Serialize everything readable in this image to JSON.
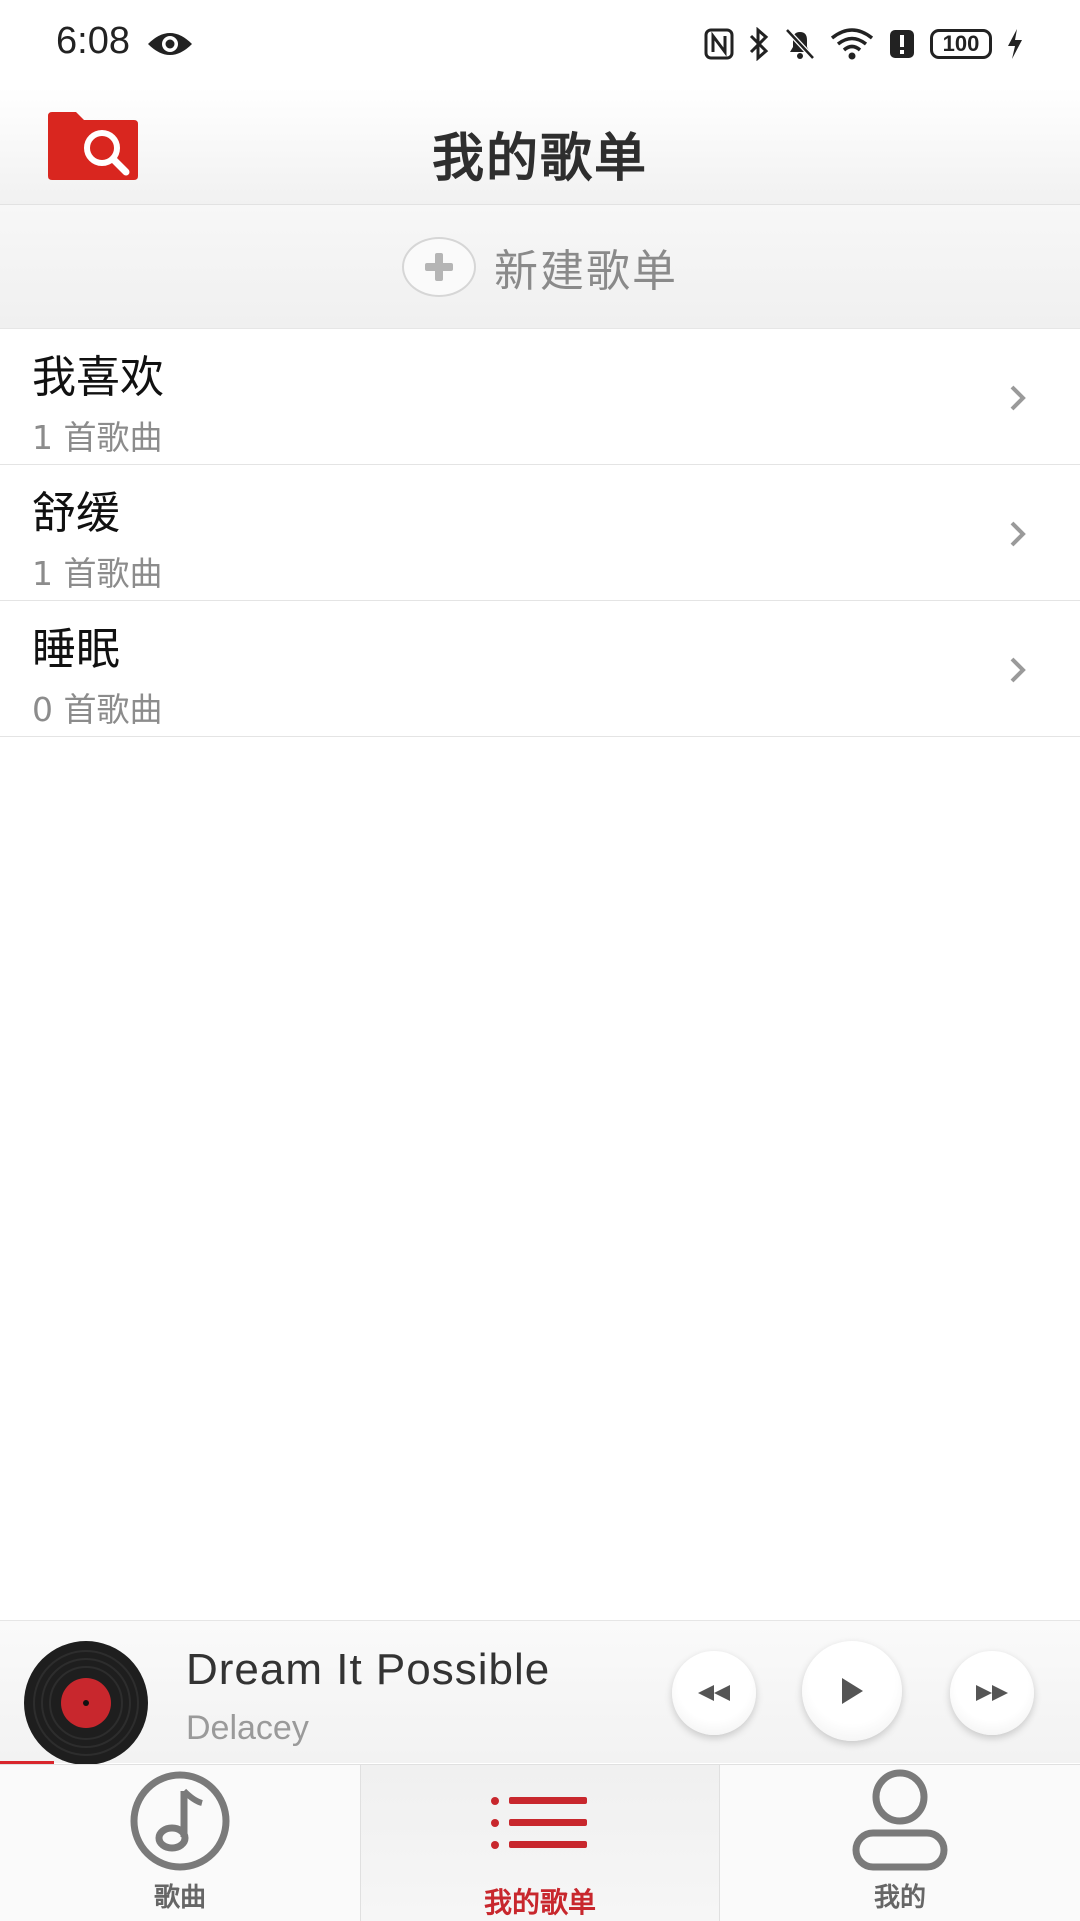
{
  "status_bar": {
    "time": "6:08",
    "battery": "100",
    "icons": [
      "eye-icon",
      "nfc-icon",
      "bluetooth-icon",
      "mute-icon",
      "wifi-icon",
      "alert-icon",
      "battery-icon",
      "charging-icon"
    ]
  },
  "header": {
    "title": "我的歌单",
    "left_icon": "folder-search-icon"
  },
  "new_playlist": {
    "label": "新建歌单",
    "icon": "plus-icon"
  },
  "playlists": [
    {
      "name": "我喜欢",
      "count": "1 首歌曲"
    },
    {
      "name": "舒缓",
      "count": "1 首歌曲"
    },
    {
      "name": "睡眠",
      "count": "0 首歌曲"
    }
  ],
  "player": {
    "title": "Dream It Possible",
    "artist": "Delacey",
    "progress_fraction": 0.05,
    "controls": [
      "rewind-icon",
      "play-icon",
      "fast-forward-icon"
    ]
  },
  "nav": {
    "tabs": [
      {
        "label": "歌曲",
        "icon": "music-note-icon"
      },
      {
        "label": "我的歌单",
        "icon": "list-icon",
        "active": true
      },
      {
        "label": "我的",
        "icon": "user-icon"
      }
    ]
  },
  "colors": {
    "accent": "#c8272d",
    "folder_icon": "#d9261f",
    "text_secondary": "#8c8c8c"
  }
}
